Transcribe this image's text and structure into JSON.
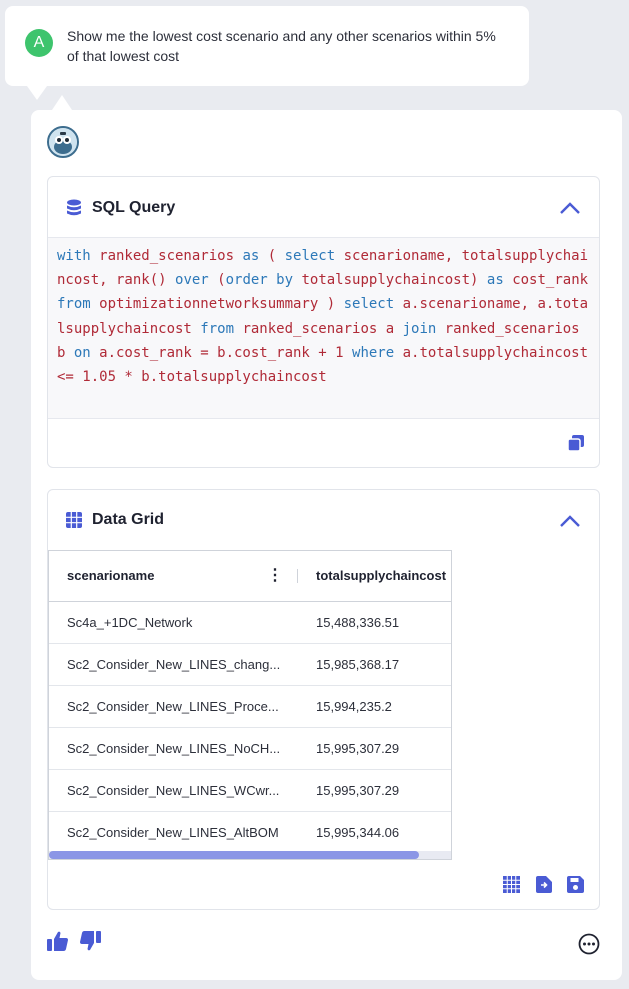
{
  "user_message": {
    "avatar_letter": "A",
    "text": "Show me the lowest cost scenario and any other scenarios within 5% of that lowest cost"
  },
  "sql_card": {
    "title": "SQL Query",
    "query_tokens": [
      {
        "t": "with",
        "k": true
      },
      {
        "t": " ranked_scenarios ",
        "k": false
      },
      {
        "t": "as",
        "k": true
      },
      {
        "t": " ( ",
        "k": false
      },
      {
        "t": "select",
        "k": true
      },
      {
        "t": " scenarioname, totalsupplychaincost, rank() ",
        "k": false
      },
      {
        "t": "over",
        "k": true
      },
      {
        "t": " (",
        "k": false
      },
      {
        "t": "order by",
        "k": true
      },
      {
        "t": " totalsupplychaincost) ",
        "k": false
      },
      {
        "t": "as",
        "k": true
      },
      {
        "t": " cost_rank ",
        "k": false
      },
      {
        "t": "from",
        "k": true
      },
      {
        "t": " optimizationnetworksummary ) ",
        "k": false
      },
      {
        "t": "select",
        "k": true
      },
      {
        "t": " a.scenarioname, a.totalsupplychaincost ",
        "k": false
      },
      {
        "t": "from",
        "k": true
      },
      {
        "t": " ranked_scenarios a ",
        "k": false
      },
      {
        "t": "join",
        "k": true
      },
      {
        "t": " ranked_scenarios b ",
        "k": false
      },
      {
        "t": "on",
        "k": true
      },
      {
        "t": " a.cost_rank = b.cost_rank + 1 ",
        "k": false
      },
      {
        "t": "where",
        "k": true
      },
      {
        "t": " a.totalsupplychaincost <= 1.05 * b.totalsupplychaincost",
        "k": false
      }
    ]
  },
  "grid_card": {
    "title": "Data Grid",
    "columns": [
      "scenarioname",
      "totalsupplychaincost"
    ],
    "rows": [
      [
        "Sc4a_+1DC_Network",
        "15,488,336.51"
      ],
      [
        "Sc2_Consider_New_LINES_chang...",
        "15,985,368.17"
      ],
      [
        "Sc2_Consider_New_LINES_Proce...",
        "15,994,235.2"
      ],
      [
        "Sc2_Consider_New_LINES_NoCH...",
        "15,995,307.29"
      ],
      [
        "Sc2_Consider_New_LINES_WCwr...",
        "15,995,307.29"
      ],
      [
        "Sc2_Consider_New_LINES_AltBOM",
        "15,995,344.06"
      ]
    ],
    "horizontal_scroll_fraction": 0.92
  },
  "icons": {
    "sql_db": "database-icon",
    "grid": "grid-icon",
    "collapse": "chevron-up-icon",
    "copy": "copy-icon",
    "table_view": "table-view-icon",
    "export": "export-file-icon",
    "save": "save-icon",
    "thumbs_up": "thumbs-up-icon",
    "thumbs_down": "thumbs-down-icon",
    "more": "more-options-icon"
  },
  "colors": {
    "accent": "#4a5bd4",
    "keyword": "#2c78b8",
    "identifier": "#b02a37",
    "user_avatar": "#3ec46d"
  }
}
